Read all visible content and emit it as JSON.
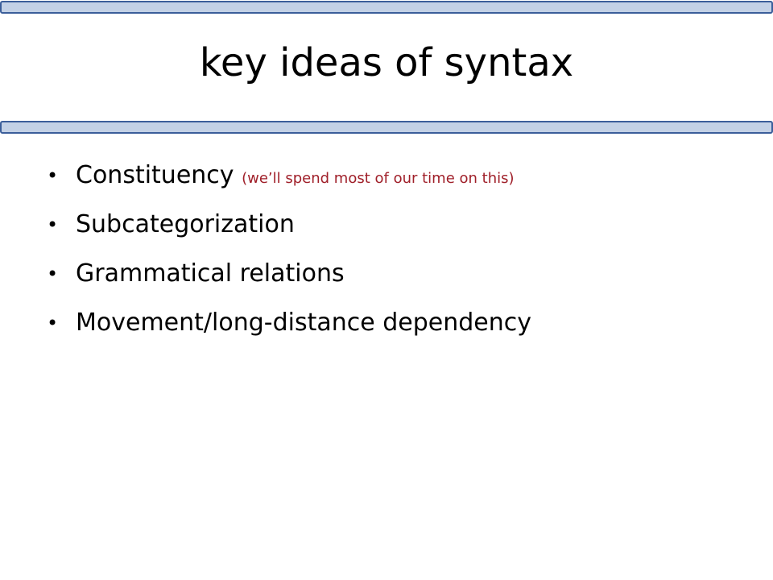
{
  "slide": {
    "title": "key ideas of syntax",
    "bullet_glyph": "•",
    "items": [
      {
        "text": "Constituency",
        "note": "(we’ll spend most of our time on this)"
      },
      {
        "text": "Subcategorization",
        "note": ""
      },
      {
        "text": "Grammatical relations",
        "note": ""
      },
      {
        "text": "Movement/long-distance dependency",
        "note": ""
      }
    ]
  },
  "colors": {
    "rule_border": "#3b5e9a",
    "rule_fill": "#c3d1e6",
    "note_text": "#a0202a",
    "text": "#000000"
  }
}
